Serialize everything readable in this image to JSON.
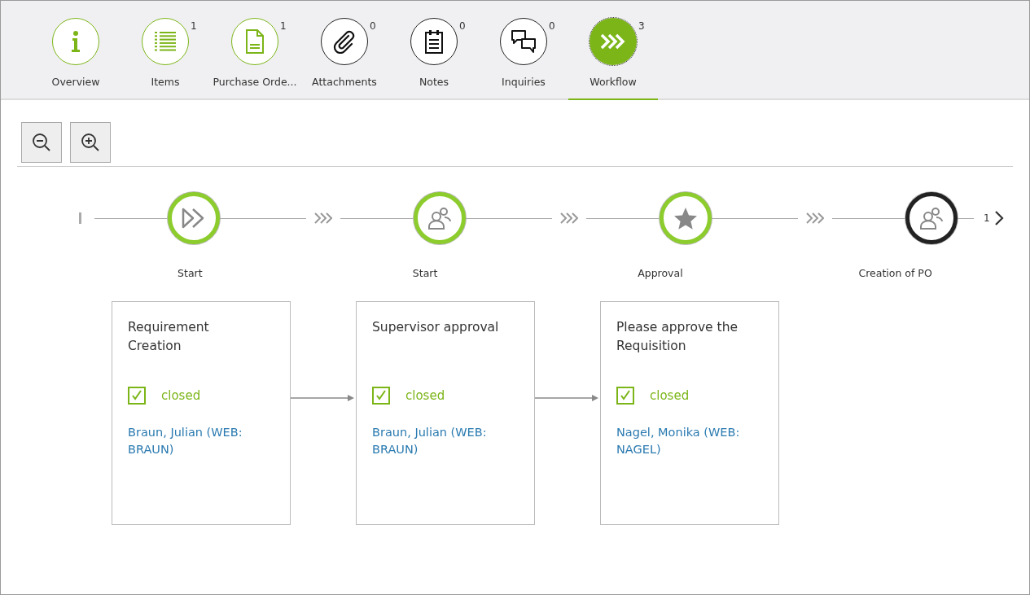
{
  "tabs": [
    {
      "label": "Overview",
      "kind": "info",
      "has_content": true,
      "selected": false
    },
    {
      "label": "Items",
      "kind": "list",
      "badge": "1",
      "has_content": true,
      "selected": false
    },
    {
      "label": "Purchase Orde...",
      "kind": "document",
      "badge": "1",
      "has_content": true,
      "selected": false
    },
    {
      "label": "Attachments",
      "kind": "paperclip",
      "badge": "0",
      "has_content": false,
      "selected": false
    },
    {
      "label": "Notes",
      "kind": "notepad",
      "badge": "0",
      "has_content": false,
      "selected": false
    },
    {
      "label": "Inquiries",
      "kind": "chat",
      "badge": "0",
      "has_content": false,
      "selected": false
    },
    {
      "label": "Workflow",
      "kind": "workflow",
      "badge": "3",
      "selected": true
    }
  ],
  "steps": [
    {
      "label": "Start",
      "kind": "start",
      "done": true
    },
    {
      "label": "Start",
      "kind": "task",
      "done": true
    },
    {
      "label": "Approval",
      "kind": "approval",
      "done": true
    },
    {
      "label": "Creation of PO",
      "kind": "task",
      "done": false
    }
  ],
  "timeline_page": "1",
  "cards": [
    {
      "title": "Requirement Creation",
      "checked": true,
      "status": "closed",
      "assignee": "Braun, Julian (WEB: BRAUN)"
    },
    {
      "title": "Supervisor approval",
      "checked": true,
      "status": "closed",
      "assignee": "Braun, Julian (WEB: BRAUN)"
    },
    {
      "title": "Please approve the Requisition",
      "checked": true,
      "status": "closed",
      "assignee": "Nagel, Monika (WEB: NAGEL)"
    }
  ]
}
